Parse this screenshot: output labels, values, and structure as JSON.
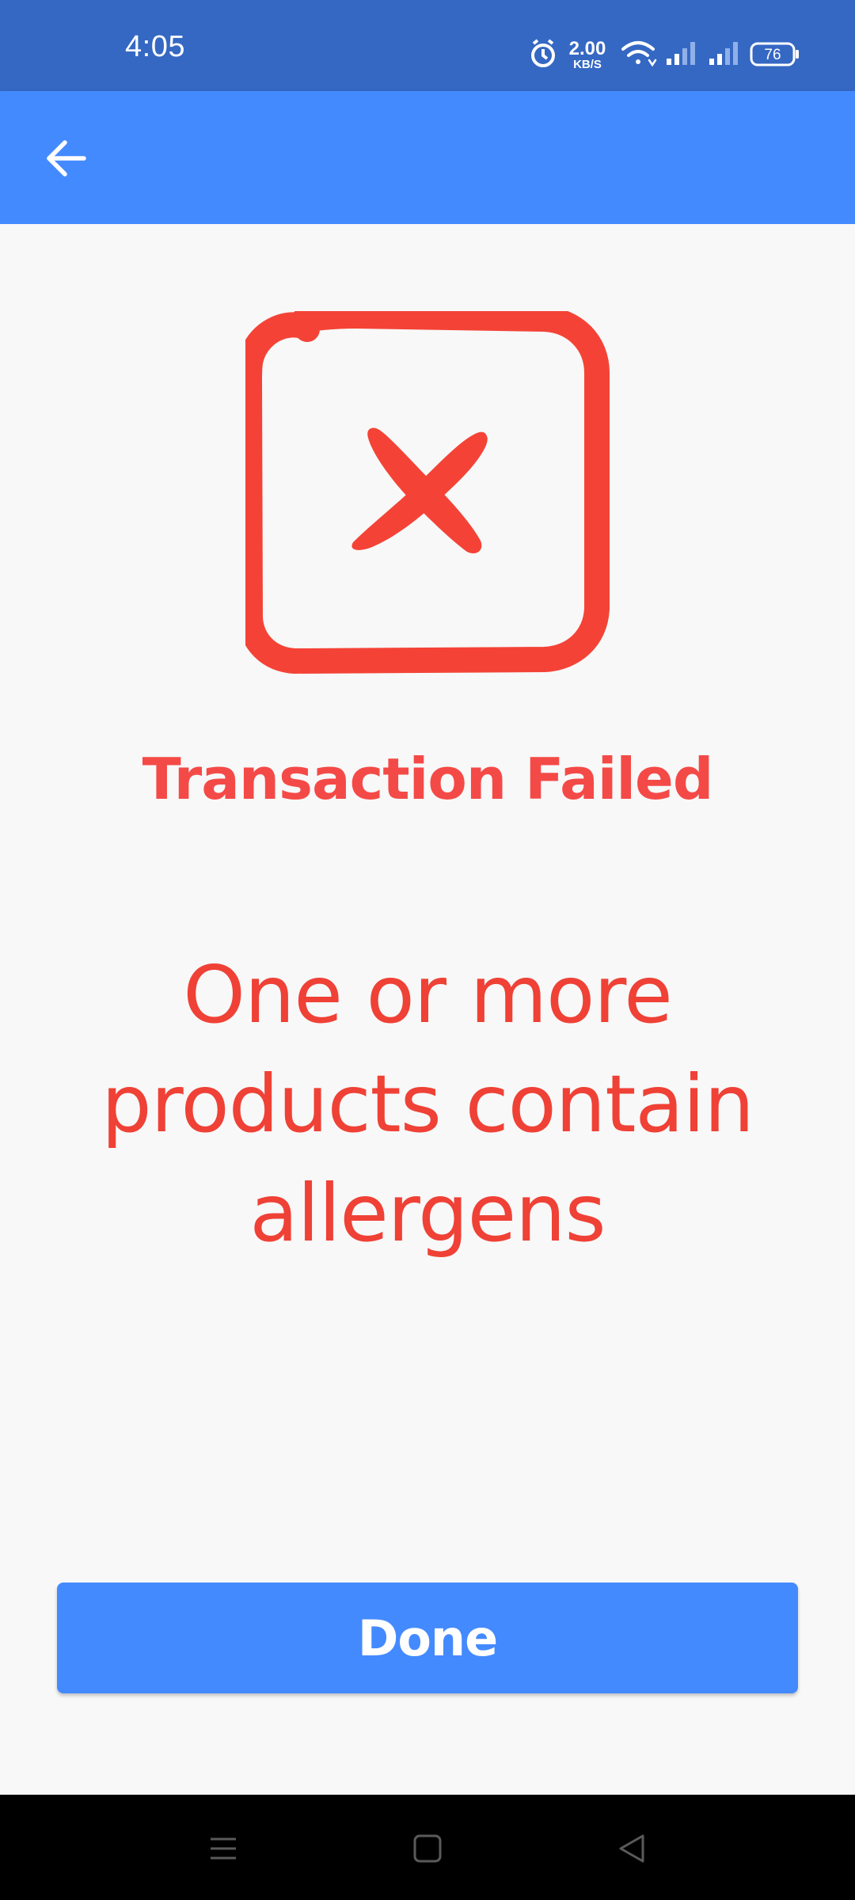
{
  "status_bar": {
    "time": "4:05",
    "net_speed_value": "2.00",
    "net_speed_unit": "KB/S",
    "battery_level": "76",
    "icons": [
      "alarm-icon",
      "wifi-icon",
      "signal-icon",
      "signal-icon",
      "battery-icon"
    ]
  },
  "app_bar": {
    "back_icon": "arrow-left-icon"
  },
  "main": {
    "status_icon": "failure-x-icon",
    "title": "Transaction Failed",
    "message": "One or more products contain allergens",
    "done_label": "Done"
  },
  "nav_bar": {
    "icons": [
      "menu-icon",
      "home-icon",
      "back-icon"
    ]
  },
  "colors": {
    "status_bar": "#3568c3",
    "app_bar": "#448aff",
    "error_red": "#f44336",
    "button": "#448aff",
    "background": "#f8f8f8"
  }
}
